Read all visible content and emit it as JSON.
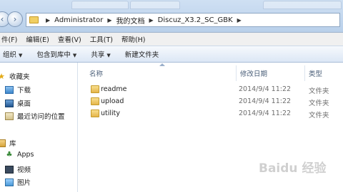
{
  "address_bar": {
    "crumbs": [
      "Administrator",
      "我的文档",
      "Discuz_X3.2_SC_GBK"
    ]
  },
  "menubar": {
    "items": [
      "件(F)",
      "编辑(E)",
      "查看(V)",
      "工具(T)",
      "帮助(H)"
    ]
  },
  "toolbar": {
    "organize": "组织",
    "include_in_library": "包含到库中",
    "share": "共享",
    "new_folder": "新建文件夹"
  },
  "navpane": {
    "favorites": "收藏夹",
    "downloads": "下载",
    "desktop": "桌面",
    "recent": "最近访问的位置",
    "library": "库",
    "apps": "Apps",
    "video": "视频",
    "pictures": "图片"
  },
  "columns": {
    "name": "名称",
    "modified": "修改日期",
    "type": "类型"
  },
  "files": [
    {
      "name": "readme",
      "modified": "2014/9/4 11:22",
      "type": "文件夹"
    },
    {
      "name": "upload",
      "modified": "2014/9/4 11:22",
      "type": "文件夹"
    },
    {
      "name": "utility",
      "modified": "2014/9/4 11:22",
      "type": "文件夹"
    }
  ],
  "watermark": "Baidu 经验"
}
